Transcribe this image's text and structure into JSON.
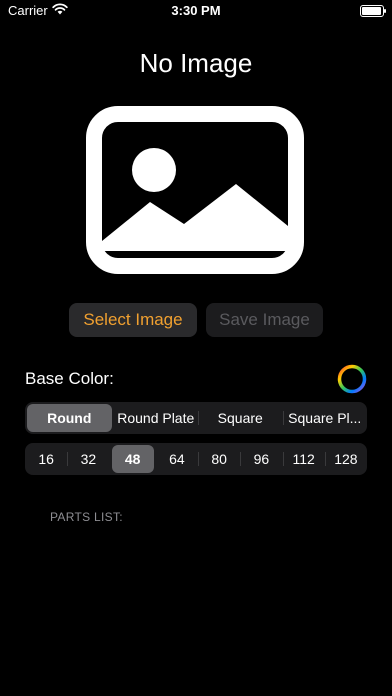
{
  "status": {
    "carrier": "Carrier",
    "time": "3:30 PM"
  },
  "title": "No Image",
  "buttons": {
    "select": "Select Image",
    "save": "Save Image"
  },
  "base_color_label": "Base Color:",
  "shapes": [
    {
      "label": "Round",
      "selected": true
    },
    {
      "label": "Round Plate",
      "selected": false
    },
    {
      "label": "Square",
      "selected": false
    },
    {
      "label": "Square Pl...",
      "selected": false
    }
  ],
  "sizes": [
    {
      "label": "16",
      "selected": false
    },
    {
      "label": "32",
      "selected": false
    },
    {
      "label": "48",
      "selected": true
    },
    {
      "label": "64",
      "selected": false
    },
    {
      "label": "80",
      "selected": false
    },
    {
      "label": "96",
      "selected": false
    },
    {
      "label": "112",
      "selected": false
    },
    {
      "label": "128",
      "selected": false
    }
  ],
  "parts_list_label": "PARTS LIST:",
  "colors": {
    "accent": "#f0a030",
    "disabled": "#5a5a5e"
  }
}
